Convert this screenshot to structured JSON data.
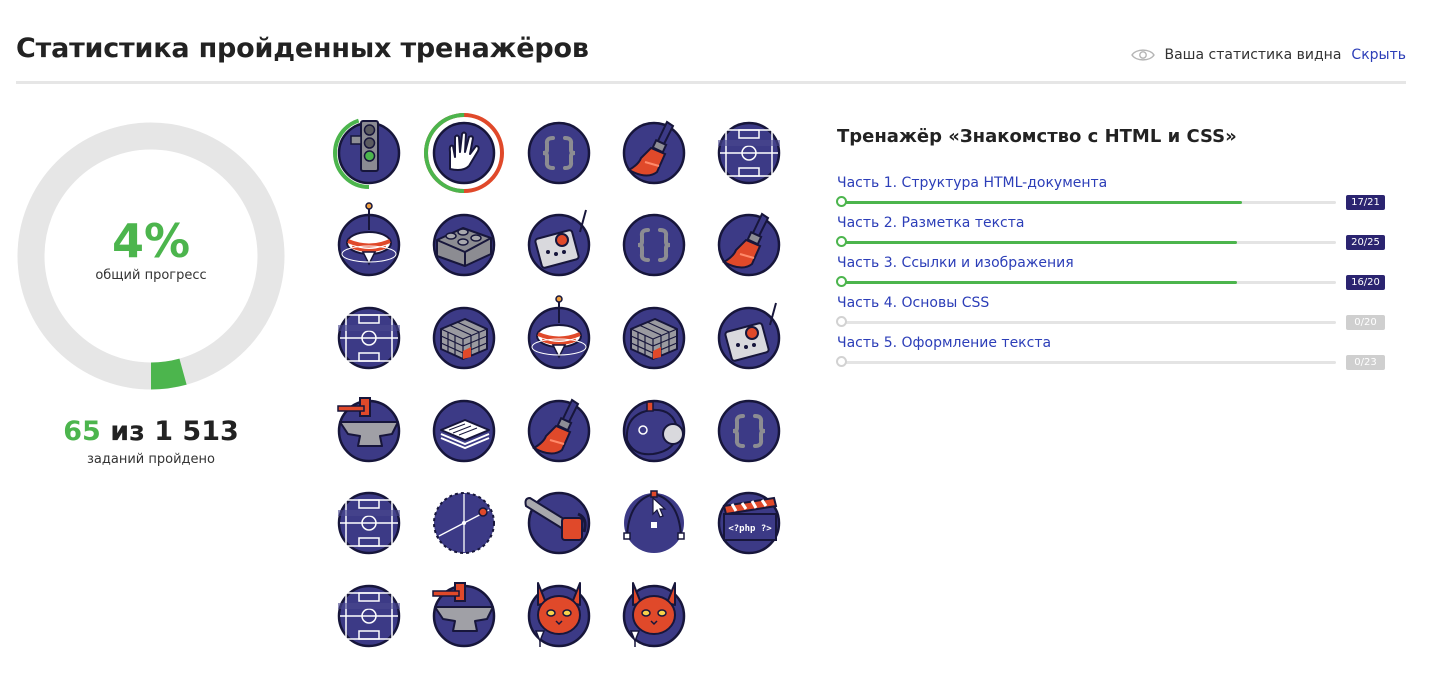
{
  "header": {
    "title": "Статистика пройденных тренажёров",
    "visibility_text": "Ваша статистика видна",
    "hide_label": "Скрыть",
    "icon": "eye-icon"
  },
  "summary": {
    "percent": "4%",
    "percent_label": "общий прогресс",
    "progress_fraction": 0.043,
    "completed": "65",
    "separator": "из",
    "total": "1 513",
    "completed_label": "заданий пройдено",
    "colors": {
      "ring_track": "#e6e6e6",
      "ring_fill": "#4cb54d",
      "accent": "#4cb54d"
    }
  },
  "badges": [
    {
      "icon": "traffic-light-icon",
      "progress": 0.45
    },
    {
      "icon": "spock-hand-icon",
      "progress": 1.0,
      "selected": true
    },
    {
      "icon": "curly-braces-icon"
    },
    {
      "icon": "paint-brush-icon"
    },
    {
      "icon": "football-field-icon"
    },
    {
      "icon": "spinning-top-icon"
    },
    {
      "icon": "lego-brick-icon"
    },
    {
      "icon": "robot-box-icon"
    },
    {
      "icon": "curly-braces-icon"
    },
    {
      "icon": "paint-brush-icon"
    },
    {
      "icon": "football-field-icon"
    },
    {
      "icon": "rubiks-cube-icon"
    },
    {
      "icon": "spinning-top-icon"
    },
    {
      "icon": "rubiks-cube-icon"
    },
    {
      "icon": "robot-box-icon"
    },
    {
      "icon": "anvil-hammer-icon"
    },
    {
      "icon": "layers-stack-icon"
    },
    {
      "icon": "paint-brush-icon"
    },
    {
      "icon": "bathyscaphe-icon"
    },
    {
      "icon": "curly-braces-icon"
    },
    {
      "icon": "football-field-icon"
    },
    {
      "icon": "orbit-globe-icon"
    },
    {
      "icon": "chainsaw-icon"
    },
    {
      "icon": "bezier-cursor-icon"
    },
    {
      "icon": "php-clapperboard-icon",
      "code_text": "<?php ?>"
    },
    {
      "icon": "football-field-icon"
    },
    {
      "icon": "anvil-hammer-icon"
    },
    {
      "icon": "cat-mascot-icon"
    },
    {
      "icon": "cat-mascot-icon"
    }
  ],
  "course": {
    "title": "Тренажёр «Знакомство с HTML и CSS»",
    "parts": [
      {
        "title": "Часть 1. Структура HTML-документа",
        "done": 17,
        "total": 21,
        "label": "17/21"
      },
      {
        "title": "Часть 2. Разметка текста",
        "done": 20,
        "total": 25,
        "label": "20/25"
      },
      {
        "title": "Часть 3. Ссылки и изображения",
        "done": 16,
        "total": 20,
        "label": "16/20"
      },
      {
        "title": "Часть 4. Основы CSS",
        "done": 0,
        "total": 20,
        "label": "0/20"
      },
      {
        "title": "Часть 5. Оформление текста",
        "done": 0,
        "total": 23,
        "label": "0/23"
      }
    ],
    "colors": {
      "link": "#2c3eb8",
      "done_tag": "#2b2470",
      "empty_tag": "#cfcfcf",
      "bar": "#4cb54d"
    }
  }
}
